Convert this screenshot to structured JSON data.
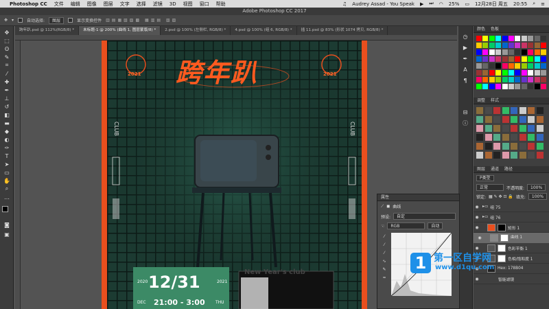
{
  "menubar": {
    "app_name": "Photoshop CC",
    "items": [
      "文件",
      "编辑",
      "图像",
      "图层",
      "文字",
      "选择",
      "滤镜",
      "3D",
      "视图",
      "窗口",
      "帮助"
    ],
    "now_playing": "Audrey Assad - You Speak",
    "battery": "25%",
    "date": "12月28日 周五",
    "time": "20:55"
  },
  "window_title": "Adobe Photoshop CC 2017",
  "options_bar": {
    "auto_select_label": "自动选择:",
    "auto_select_value": "图层",
    "show_transform_label": "显示变换控件"
  },
  "doc_tabs": [
    {
      "label": "跨年趴.psd @ 112%(RGB/8) *",
      "active": false
    },
    {
      "label": "未标题-1 @ 200% (曲线 1, 图层蒙版/8) *",
      "active": true
    },
    {
      "label": "2.psd @ 100% (左侧栏, RGB/8) *",
      "active": false
    },
    {
      "label": "4.psd @ 100% (组 6, RGB/8) *",
      "active": false
    },
    {
      "label": "插 11.psd @ 83% (形状 1074 拷贝, RGB/8) *",
      "active": false
    }
  ],
  "poster": {
    "title": "跨年趴",
    "year_badge": "2021",
    "side_text": "CLUB",
    "date_big": "12/31",
    "year_left": "2020",
    "year_right": "2021",
    "time_line": "21:00 - 3:00",
    "month": "DEC",
    "weekday": "THU",
    "promo_title": "New Year's club"
  },
  "panels": {
    "color_tabs": [
      "颜色",
      "色板"
    ],
    "adjust_tabs": [
      "调整",
      "样式"
    ],
    "layer_tabs": [
      "图层",
      "通道",
      "路径"
    ],
    "filter_kind": "P类型",
    "blend_mode": "正常",
    "opacity_label": "不透明度:",
    "opacity_value": "100%",
    "lock_label": "锁定:",
    "fill_label": "填充:",
    "fill_value": "100%"
  },
  "layers": [
    {
      "name": "组 75",
      "visible": true,
      "type": "group",
      "selected": false
    },
    {
      "name": "组 76",
      "visible": true,
      "type": "group",
      "selected": false
    },
    {
      "name": "矩形 1",
      "visible": true,
      "type": "shape",
      "selected": false
    },
    {
      "name": "曲线 1",
      "visible": true,
      "type": "adjust",
      "selected": true
    },
    {
      "name": "色彩平衡 1",
      "visible": true,
      "type": "adjust",
      "selected": false
    },
    {
      "name": "色相/饱和度 1",
      "visible": true,
      "type": "adjust",
      "selected": false
    },
    {
      "name": "Hex: 178B04",
      "visible": true,
      "type": "pixel",
      "selected": false
    },
    {
      "name": "智能滤镜",
      "visible": true,
      "type": "filter",
      "selected": false
    }
  ],
  "properties": {
    "tab": "属性",
    "title": "曲线",
    "preset_label": "预设:",
    "preset_value": "自定",
    "channel_value": "RGB",
    "auto_button": "自动"
  },
  "watermark": {
    "brand": "第一区自学网",
    "url": "www.d1qu.com"
  },
  "colors": {
    "accent_orange": "#ff5a1f",
    "poster_green": "#1f4a3e",
    "panel_bg": "#3f3f3f"
  }
}
